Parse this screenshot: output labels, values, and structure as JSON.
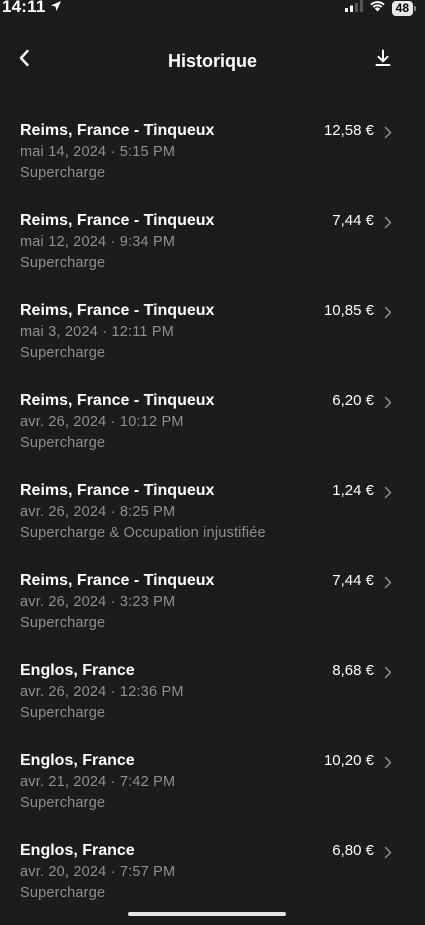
{
  "status_bar": {
    "time": "14:11",
    "battery": "48"
  },
  "header": {
    "title": "Historique"
  },
  "icons": {
    "back": "chevron-left-icon",
    "download": "download-icon",
    "row_chevron": "chevron-right-icon",
    "location_arrow": "location-arrow-icon",
    "signal": "signal-icon",
    "wifi": "wifi-icon"
  },
  "colors": {
    "background": "#1c1c1e",
    "primary_text": "#ffffff",
    "secondary_text": "#8e8e93"
  },
  "history": [
    {
      "location": "Reims, France - Tinqueux",
      "datetime": "mai 14, 2024 · 5:15 PM",
      "type": "Supercharge",
      "amount": "12,58 €"
    },
    {
      "location": "Reims, France - Tinqueux",
      "datetime": "mai 12, 2024 · 9:34 PM",
      "type": "Supercharge",
      "amount": "7,44 €"
    },
    {
      "location": "Reims, France - Tinqueux",
      "datetime": "mai 3, 2024 · 12:11 PM",
      "type": "Supercharge",
      "amount": "10,85 €"
    },
    {
      "location": "Reims, France - Tinqueux",
      "datetime": "avr. 26, 2024 · 10:12 PM",
      "type": "Supercharge",
      "amount": "6,20 €"
    },
    {
      "location": "Reims, France - Tinqueux",
      "datetime": "avr. 26, 2024 · 8:25 PM",
      "type": "Supercharge & Occupation injustifiée",
      "amount": "1,24 €"
    },
    {
      "location": "Reims, France - Tinqueux",
      "datetime": "avr. 26, 2024 · 3:23 PM",
      "type": "Supercharge",
      "amount": "7,44 €"
    },
    {
      "location": "Englos, France",
      "datetime": "avr. 26, 2024 · 12:36 PM",
      "type": "Supercharge",
      "amount": "8,68 €"
    },
    {
      "location": "Englos, France",
      "datetime": "avr. 21, 2024 · 7:42 PM",
      "type": "Supercharge",
      "amount": "10,20 €"
    },
    {
      "location": "Englos, France",
      "datetime": "avr. 20, 2024 · 7:57 PM",
      "type": "Supercharge",
      "amount": "6,80 €"
    }
  ]
}
